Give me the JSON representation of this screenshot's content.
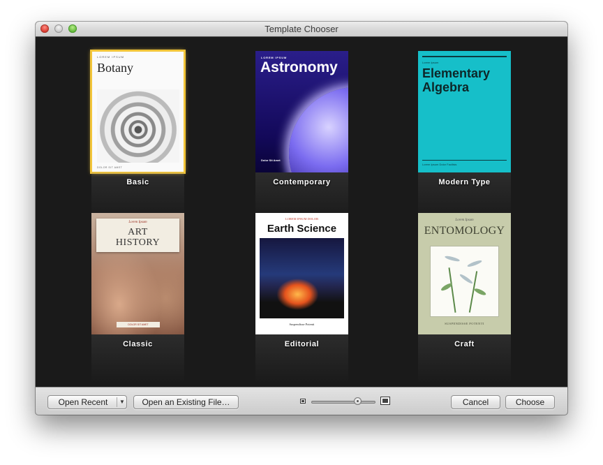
{
  "window": {
    "title": "Template Chooser"
  },
  "templates": [
    {
      "name": "Basic",
      "selected": true,
      "cover": {
        "small": "LOREM IPSUM",
        "title": "Botany",
        "footer": "DOLOR SIT AMET"
      }
    },
    {
      "name": "Contemporary",
      "selected": false,
      "cover": {
        "small": "LOREM IPSUM",
        "title": "Astronomy",
        "footer": "Dolor Sit Amet"
      }
    },
    {
      "name": "Modern Type",
      "selected": false,
      "cover": {
        "small": "Lorem Ipsum",
        "title_line1": "Elementary",
        "title_line2": "Algebra",
        "footer": "Lorem Ipsum Dolor Facilisis"
      }
    },
    {
      "name": "Classic",
      "selected": false,
      "cover": {
        "small": "Lorem Ipsum",
        "title_line1": "ART",
        "title_line2": "HISTORY",
        "footer": "DOLOR SIT AMET"
      }
    },
    {
      "name": "Editorial",
      "selected": false,
      "cover": {
        "small": "LOREM IPSUM DOLOR",
        "title": "Earth Science",
        "footer": "Suspendisse Potenti"
      }
    },
    {
      "name": "Craft",
      "selected": false,
      "cover": {
        "small": "Lorem Ipsum",
        "title": "ENTOMOLOGY",
        "footer": "SUSPENDISSE POTENTI"
      }
    }
  ],
  "toolbar": {
    "open_recent_label": "Open Recent",
    "open_existing_label": "Open an Existing File…",
    "cancel_label": "Cancel",
    "choose_label": "Choose",
    "zoom_level": 0.75
  },
  "colors": {
    "selection": "#f2c53a",
    "background": "#1a1a1a"
  }
}
